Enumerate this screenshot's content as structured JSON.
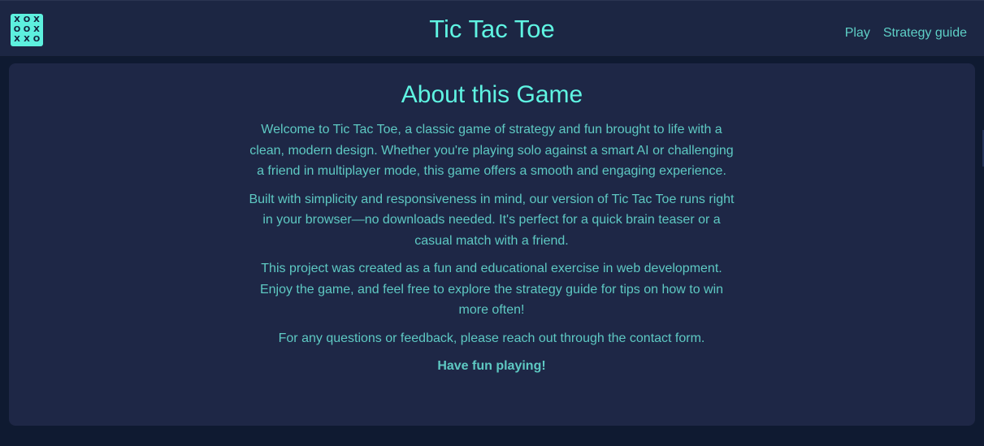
{
  "header": {
    "logo_cells": [
      "X",
      "O",
      "X",
      "O",
      "O",
      "X",
      "X",
      "X",
      "O"
    ],
    "title": "Tic Tac Toe",
    "nav": {
      "play": "Play",
      "strategy": "Strategy guide"
    }
  },
  "about": {
    "heading": "About this Game",
    "paragraphs": [
      "Welcome to Tic Tac Toe, a classic game of strategy and fun brought to life with a clean, modern design. Whether you're playing solo against a smart AI or challenging a friend in multiplayer mode, this game offers a smooth and engaging experience.",
      "Built with simplicity and responsiveness in mind, our version of Tic Tac Toe runs right in your browser—no downloads needed. It's perfect for a quick brain teaser or a casual match with a friend.",
      "This project was created as a fun and educational exercise in web development. Enjoy the game, and feel free to explore the strategy guide for tips on how to win more often!",
      "For any questions or feedback, please reach out through the contact form."
    ],
    "closing": "Have fun playing!"
  },
  "colors": {
    "accent": "#5ff4e2",
    "text": "#5ec9c3",
    "header_bg": "#1c2643",
    "card_bg": "#1e2746",
    "page_bg": "#0f1a31"
  }
}
